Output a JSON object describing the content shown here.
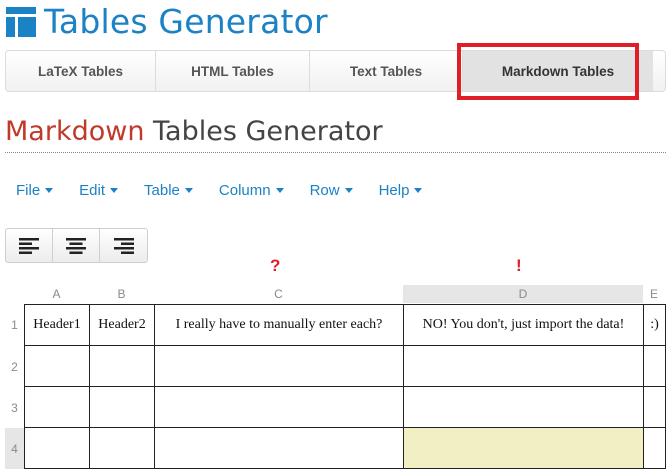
{
  "header": {
    "title": "Tables Generator"
  },
  "tabs": [
    {
      "label": "LaTeX Tables"
    },
    {
      "label": "HTML Tables"
    },
    {
      "label": "Text Tables"
    },
    {
      "label": "Markdown Tables",
      "active": true
    }
  ],
  "page": {
    "title_accent": "Markdown",
    "title_rest": " Tables Generator"
  },
  "menu": [
    {
      "label": "File"
    },
    {
      "label": "Edit"
    },
    {
      "label": "Table"
    },
    {
      "label": "Column"
    },
    {
      "label": "Row"
    },
    {
      "label": "Help"
    }
  ],
  "toolbar": {
    "align_buttons": [
      "align-left-icon",
      "align-center-icon",
      "align-right-icon"
    ]
  },
  "annotations": {
    "question_mark": "?",
    "exclamation_mark": "!"
  },
  "grid": {
    "columns": [
      "A",
      "B",
      "C",
      "D",
      "E"
    ],
    "rows": [
      "1",
      "2",
      "3",
      "4"
    ],
    "cells": [
      [
        "Header1",
        "Header2",
        "I really have to manually enter each?",
        "NO! You don't, just import the data!",
        ":)"
      ],
      [
        "",
        "",
        "",
        "",
        ""
      ],
      [
        "",
        "",
        "",
        "",
        ""
      ],
      [
        "",
        "",
        "",
        "",
        ""
      ]
    ],
    "selected_cell": {
      "row": 4,
      "column": "D"
    }
  },
  "colors": {
    "brand": "#1b82c5",
    "accent_red": "#c0392b",
    "highlight": "#e01e25",
    "selected_cell": "#f3efc4"
  }
}
